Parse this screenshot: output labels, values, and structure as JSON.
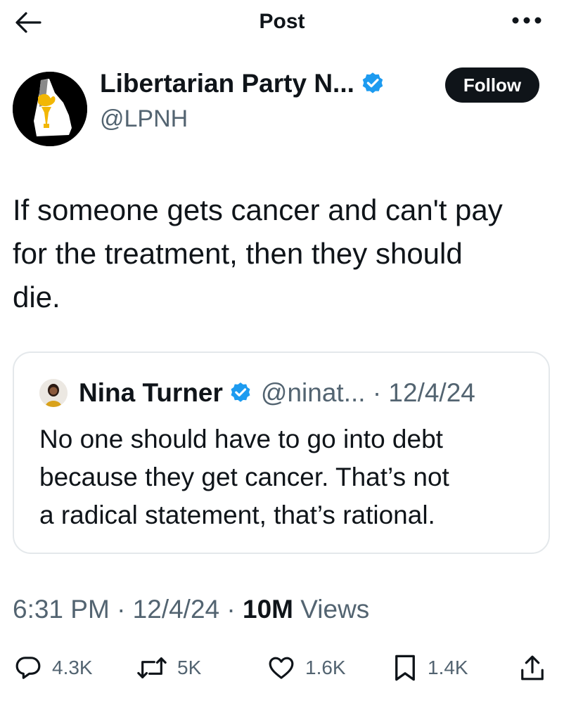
{
  "header": {
    "title": "Post"
  },
  "author": {
    "name": "Libertarian Party N...",
    "handle": "@LPNH",
    "verified": true
  },
  "follow_label": "Follow",
  "tweet": {
    "text_lines": [
      "If someone gets cancer and can't pay",
      "for the treatment, then they should",
      "die."
    ]
  },
  "quote": {
    "name": "Nina Turner",
    "meta": "@ninat... · 12/4/24",
    "text_lines": [
      "No one should have to go into debt",
      "because they get cancer. That’s not",
      "a radical statement, that’s rational."
    ]
  },
  "stats": {
    "time": "6:31 PM · 12/4/24 · ",
    "views_count": "10M",
    "views_label": " Views"
  },
  "actions": {
    "replies": "4.3K",
    "reposts": "5K",
    "likes": "1.6K",
    "bookmarks": "1.4K"
  },
  "colors": {
    "verified": "#1d9bf0",
    "secondary_text": "#536471",
    "follow_bg": "#0f1419"
  }
}
